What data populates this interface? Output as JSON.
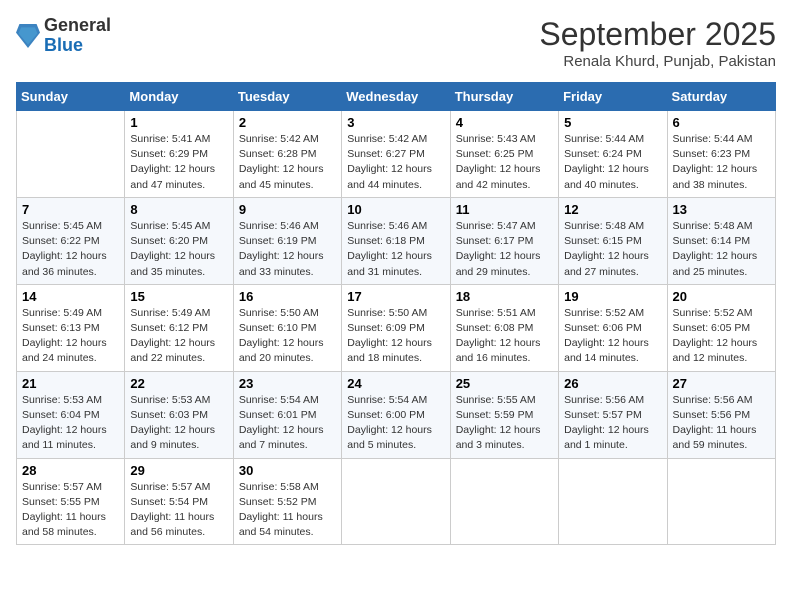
{
  "header": {
    "logo_general": "General",
    "logo_blue": "Blue",
    "month_title": "September 2025",
    "subtitle": "Renala Khurd, Punjab, Pakistan"
  },
  "days_of_week": [
    "Sunday",
    "Monday",
    "Tuesday",
    "Wednesday",
    "Thursday",
    "Friday",
    "Saturday"
  ],
  "weeks": [
    [
      {
        "day": "",
        "info": ""
      },
      {
        "day": "1",
        "info": "Sunrise: 5:41 AM\nSunset: 6:29 PM\nDaylight: 12 hours\nand 47 minutes."
      },
      {
        "day": "2",
        "info": "Sunrise: 5:42 AM\nSunset: 6:28 PM\nDaylight: 12 hours\nand 45 minutes."
      },
      {
        "day": "3",
        "info": "Sunrise: 5:42 AM\nSunset: 6:27 PM\nDaylight: 12 hours\nand 44 minutes."
      },
      {
        "day": "4",
        "info": "Sunrise: 5:43 AM\nSunset: 6:25 PM\nDaylight: 12 hours\nand 42 minutes."
      },
      {
        "day": "5",
        "info": "Sunrise: 5:44 AM\nSunset: 6:24 PM\nDaylight: 12 hours\nand 40 minutes."
      },
      {
        "day": "6",
        "info": "Sunrise: 5:44 AM\nSunset: 6:23 PM\nDaylight: 12 hours\nand 38 minutes."
      }
    ],
    [
      {
        "day": "7",
        "info": "Sunrise: 5:45 AM\nSunset: 6:22 PM\nDaylight: 12 hours\nand 36 minutes."
      },
      {
        "day": "8",
        "info": "Sunrise: 5:45 AM\nSunset: 6:20 PM\nDaylight: 12 hours\nand 35 minutes."
      },
      {
        "day": "9",
        "info": "Sunrise: 5:46 AM\nSunset: 6:19 PM\nDaylight: 12 hours\nand 33 minutes."
      },
      {
        "day": "10",
        "info": "Sunrise: 5:46 AM\nSunset: 6:18 PM\nDaylight: 12 hours\nand 31 minutes."
      },
      {
        "day": "11",
        "info": "Sunrise: 5:47 AM\nSunset: 6:17 PM\nDaylight: 12 hours\nand 29 minutes."
      },
      {
        "day": "12",
        "info": "Sunrise: 5:48 AM\nSunset: 6:15 PM\nDaylight: 12 hours\nand 27 minutes."
      },
      {
        "day": "13",
        "info": "Sunrise: 5:48 AM\nSunset: 6:14 PM\nDaylight: 12 hours\nand 25 minutes."
      }
    ],
    [
      {
        "day": "14",
        "info": "Sunrise: 5:49 AM\nSunset: 6:13 PM\nDaylight: 12 hours\nand 24 minutes."
      },
      {
        "day": "15",
        "info": "Sunrise: 5:49 AM\nSunset: 6:12 PM\nDaylight: 12 hours\nand 22 minutes."
      },
      {
        "day": "16",
        "info": "Sunrise: 5:50 AM\nSunset: 6:10 PM\nDaylight: 12 hours\nand 20 minutes."
      },
      {
        "day": "17",
        "info": "Sunrise: 5:50 AM\nSunset: 6:09 PM\nDaylight: 12 hours\nand 18 minutes."
      },
      {
        "day": "18",
        "info": "Sunrise: 5:51 AM\nSunset: 6:08 PM\nDaylight: 12 hours\nand 16 minutes."
      },
      {
        "day": "19",
        "info": "Sunrise: 5:52 AM\nSunset: 6:06 PM\nDaylight: 12 hours\nand 14 minutes."
      },
      {
        "day": "20",
        "info": "Sunrise: 5:52 AM\nSunset: 6:05 PM\nDaylight: 12 hours\nand 12 minutes."
      }
    ],
    [
      {
        "day": "21",
        "info": "Sunrise: 5:53 AM\nSunset: 6:04 PM\nDaylight: 12 hours\nand 11 minutes."
      },
      {
        "day": "22",
        "info": "Sunrise: 5:53 AM\nSunset: 6:03 PM\nDaylight: 12 hours\nand 9 minutes."
      },
      {
        "day": "23",
        "info": "Sunrise: 5:54 AM\nSunset: 6:01 PM\nDaylight: 12 hours\nand 7 minutes."
      },
      {
        "day": "24",
        "info": "Sunrise: 5:54 AM\nSunset: 6:00 PM\nDaylight: 12 hours\nand 5 minutes."
      },
      {
        "day": "25",
        "info": "Sunrise: 5:55 AM\nSunset: 5:59 PM\nDaylight: 12 hours\nand 3 minutes."
      },
      {
        "day": "26",
        "info": "Sunrise: 5:56 AM\nSunset: 5:57 PM\nDaylight: 12 hours\nand 1 minute."
      },
      {
        "day": "27",
        "info": "Sunrise: 5:56 AM\nSunset: 5:56 PM\nDaylight: 11 hours\nand 59 minutes."
      }
    ],
    [
      {
        "day": "28",
        "info": "Sunrise: 5:57 AM\nSunset: 5:55 PM\nDaylight: 11 hours\nand 58 minutes."
      },
      {
        "day": "29",
        "info": "Sunrise: 5:57 AM\nSunset: 5:54 PM\nDaylight: 11 hours\nand 56 minutes."
      },
      {
        "day": "30",
        "info": "Sunrise: 5:58 AM\nSunset: 5:52 PM\nDaylight: 11 hours\nand 54 minutes."
      },
      {
        "day": "",
        "info": ""
      },
      {
        "day": "",
        "info": ""
      },
      {
        "day": "",
        "info": ""
      },
      {
        "day": "",
        "info": ""
      }
    ]
  ]
}
